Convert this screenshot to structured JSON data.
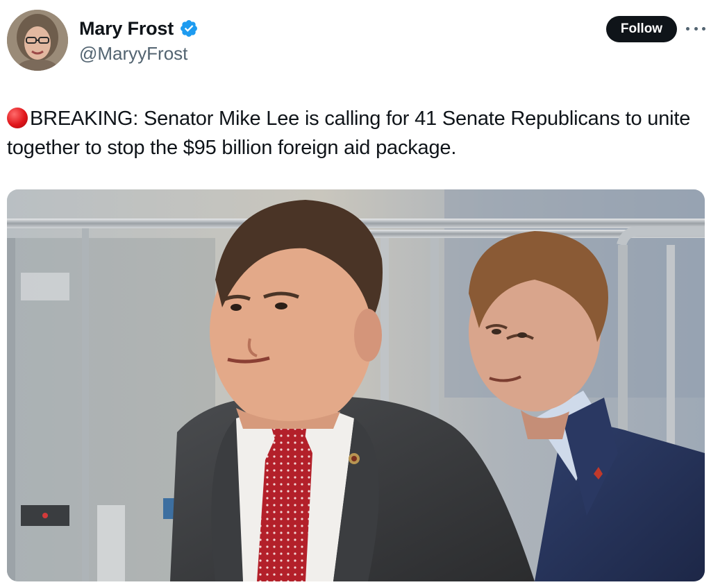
{
  "author": {
    "display_name": "Mary Frost",
    "handle": "@MaryyFrost",
    "verified": true,
    "avatar_icon": "profile-photo"
  },
  "actions": {
    "follow_label": "Follow",
    "more_icon": "more-icon"
  },
  "tweet": {
    "emoji": "red-circle-emoji",
    "text": "BREAKING: Senator Mike Lee is calling for 41 Senate Republicans to unite together to stop the $95 billion foreign aid package."
  },
  "media": {
    "kind": "photo",
    "accent_colors": {
      "verified_blue": "#1d9bf0",
      "follow_bg": "#0f1419",
      "handle_gray": "#536471"
    }
  }
}
